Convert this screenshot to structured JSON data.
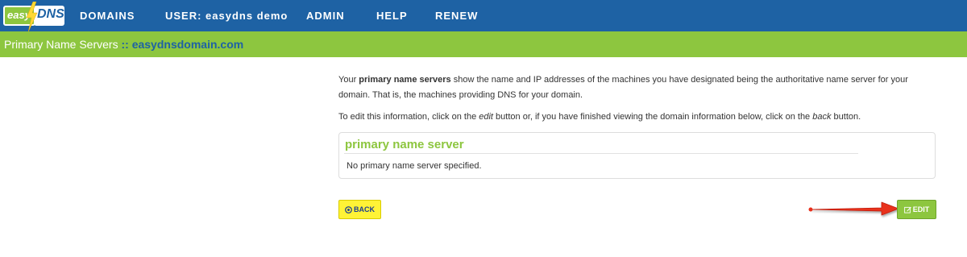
{
  "logo": {
    "easy": "easy",
    "dns": "DNS"
  },
  "nav": {
    "domains": "DOMAINS",
    "user": "USER: easydns demo",
    "admin": "ADMIN",
    "help": "HELP",
    "renew": "RENEW"
  },
  "subheader": {
    "title": "Primary Name Servers",
    "separator": "::",
    "domain": "easydnsdomain.com"
  },
  "intro": {
    "p1_a": "Your ",
    "p1_bold": "primary name servers",
    "p1_b": " show the name and IP addresses of the machines you have designated being the authoritative name server for your domain. That is, the machines providing DNS for your domain.",
    "p2_a": "To edit this information, click on the ",
    "p2_edit": "edit",
    "p2_b": " button or, if you have finished viewing the domain information below, click on the ",
    "p2_back": "back",
    "p2_c": " button."
  },
  "panel": {
    "heading": "primary name server",
    "body": "No primary name server specified."
  },
  "buttons": {
    "back_label": "BACK",
    "edit_label": "EDIT"
  },
  "colors": {
    "nav_bg": "#1e62a4",
    "accent_green": "#8dc63f",
    "back_yellow": "#fff336",
    "arrow_red": "#e8301c"
  }
}
